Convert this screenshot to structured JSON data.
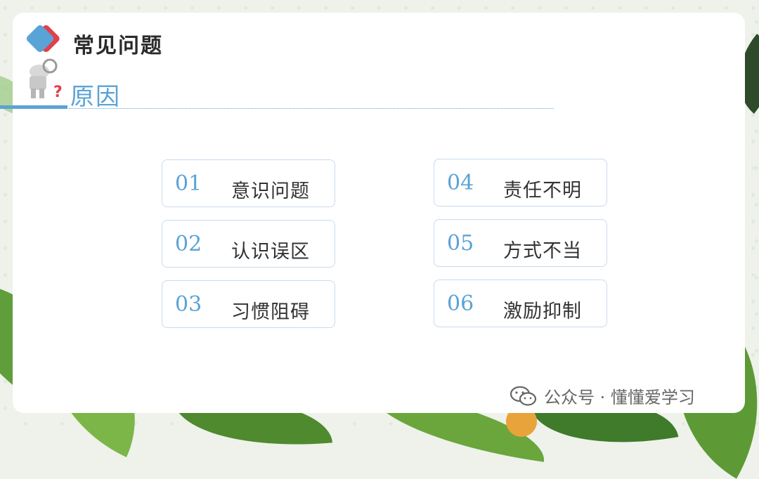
{
  "header": {
    "title": "常见问题",
    "section": "原因"
  },
  "items": [
    {
      "num": "01",
      "label": "意识问题"
    },
    {
      "num": "02",
      "label": "认识误区"
    },
    {
      "num": "03",
      "label": "习惯阻碍"
    },
    {
      "num": "04",
      "label": "责任不明"
    },
    {
      "num": "05",
      "label": "方式不当"
    },
    {
      "num": "06",
      "label": "激励抑制"
    }
  ],
  "watermark": {
    "text": "公众号 · 懂懂爱学习"
  },
  "colors": {
    "accent": "#5aa3d6",
    "accent_red": "#e0404a",
    "text": "#333333"
  },
  "icons": {
    "logo": "diamond-logo-icon",
    "figure": "thinking-figure-question-icon",
    "watermark": "wechat-icon"
  }
}
